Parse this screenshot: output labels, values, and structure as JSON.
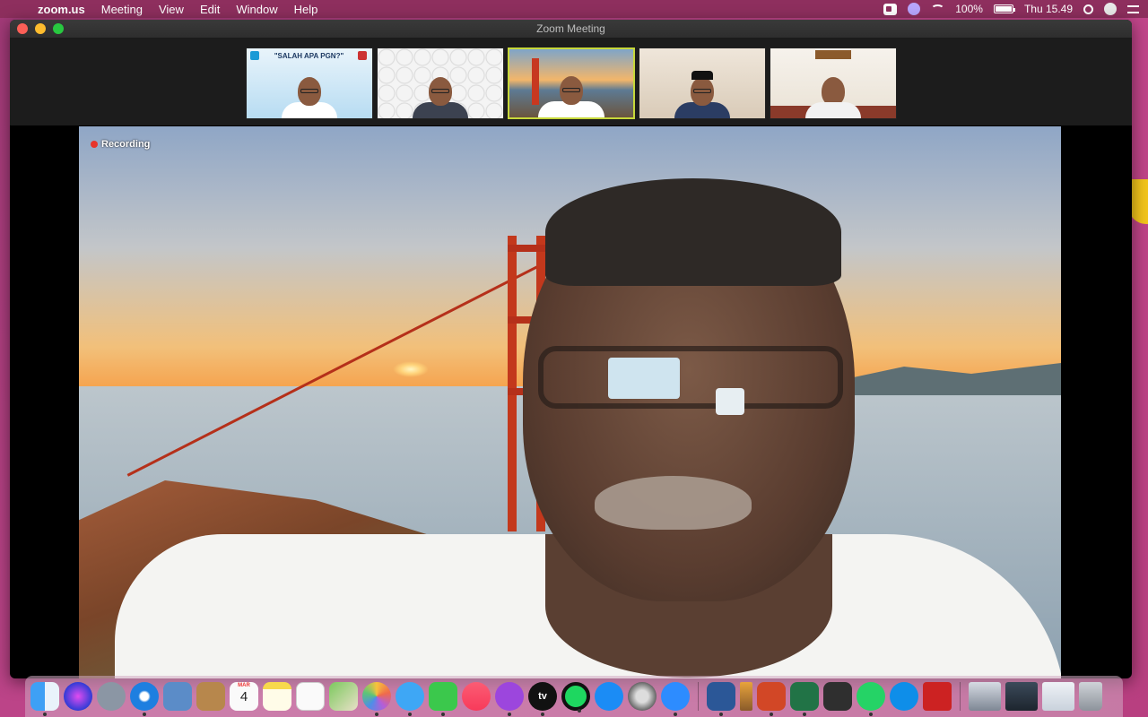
{
  "menubar": {
    "app_name": "zoom.us",
    "menus": [
      "Meeting",
      "View",
      "Edit",
      "Window",
      "Help"
    ],
    "battery": "100%",
    "clock": "Thu 15.49"
  },
  "window": {
    "title": "Zoom Meeting"
  },
  "thumbnails": [
    {
      "name": "participant-1",
      "slide_title": "\"SALAH APA PGN?\""
    },
    {
      "name": "participant-2"
    },
    {
      "name": "participant-3",
      "active": true
    },
    {
      "name": "participant-4"
    },
    {
      "name": "participant-5"
    }
  ],
  "main": {
    "recording_label": "Recording"
  },
  "dock": {
    "calendar_month": "MAR",
    "calendar_day": "4",
    "tv_label": "tv",
    "apps": [
      "finder",
      "siri",
      "launchpad",
      "safari",
      "mail",
      "contacts",
      "calendar",
      "notes",
      "reminders",
      "maps",
      "photos",
      "messages",
      "facetime",
      "music",
      "podcasts",
      "tv",
      "spotify",
      "app-store",
      "system-preferences",
      "zoom",
      "word",
      "pencil",
      "powerpoint",
      "excel",
      "calculator",
      "whatsapp",
      "teamviewer",
      "parallels",
      "screenshot-1",
      "screenshot-2",
      "screenshot-3",
      "trash"
    ]
  },
  "colors": {
    "menubar": "#8e2f5e",
    "desktop": "#b83f80",
    "recording_dot": "#e8352b",
    "active_tile_border": "#c7d83a"
  }
}
